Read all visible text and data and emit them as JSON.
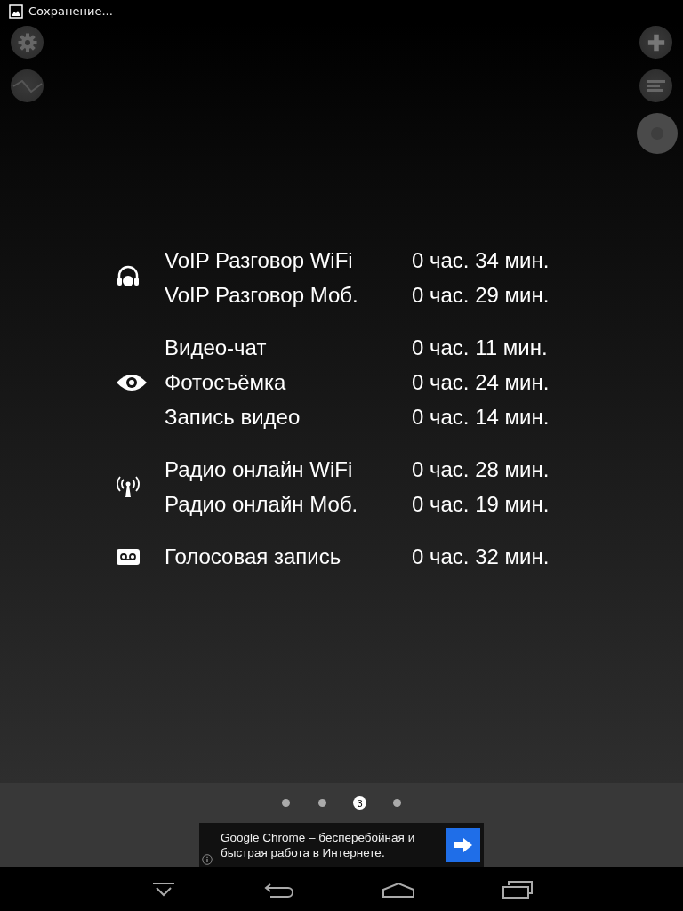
{
  "status_bar": {
    "notification": "Сохранение..."
  },
  "groups": [
    {
      "kind": "headset",
      "rows": [
        {
          "label": "VoIP Разговор WiFi",
          "value": "0 час. 34 мин."
        },
        {
          "label": "VoIP Разговор Моб.",
          "value": "0 час. 29 мин."
        }
      ]
    },
    {
      "kind": "eye",
      "rows": [
        {
          "label": "Видео-чат",
          "value": "0 час. 11 мин."
        },
        {
          "label": "Фотосъёмка",
          "value": "0 час. 24 мин."
        },
        {
          "label": "Запись видео",
          "value": "0 час. 14 мин."
        }
      ]
    },
    {
      "kind": "antenna",
      "rows": [
        {
          "label": "Радио онлайн WiFi",
          "value": "0 час. 28 мин."
        },
        {
          "label": "Радио онлайн Моб.",
          "value": "0 час. 19 мин."
        }
      ]
    },
    {
      "kind": "voicemail",
      "rows": [
        {
          "label": "Голосовая запись",
          "value": "0 час. 32 мин."
        }
      ]
    }
  ],
  "pager": [
    {
      "selected": false
    },
    {
      "selected": false
    },
    {
      "selected": true,
      "label": "3"
    },
    {
      "selected": false
    }
  ],
  "ad": {
    "text": "Google Chrome – бесперебойная и быстрая работа в Интернете."
  }
}
